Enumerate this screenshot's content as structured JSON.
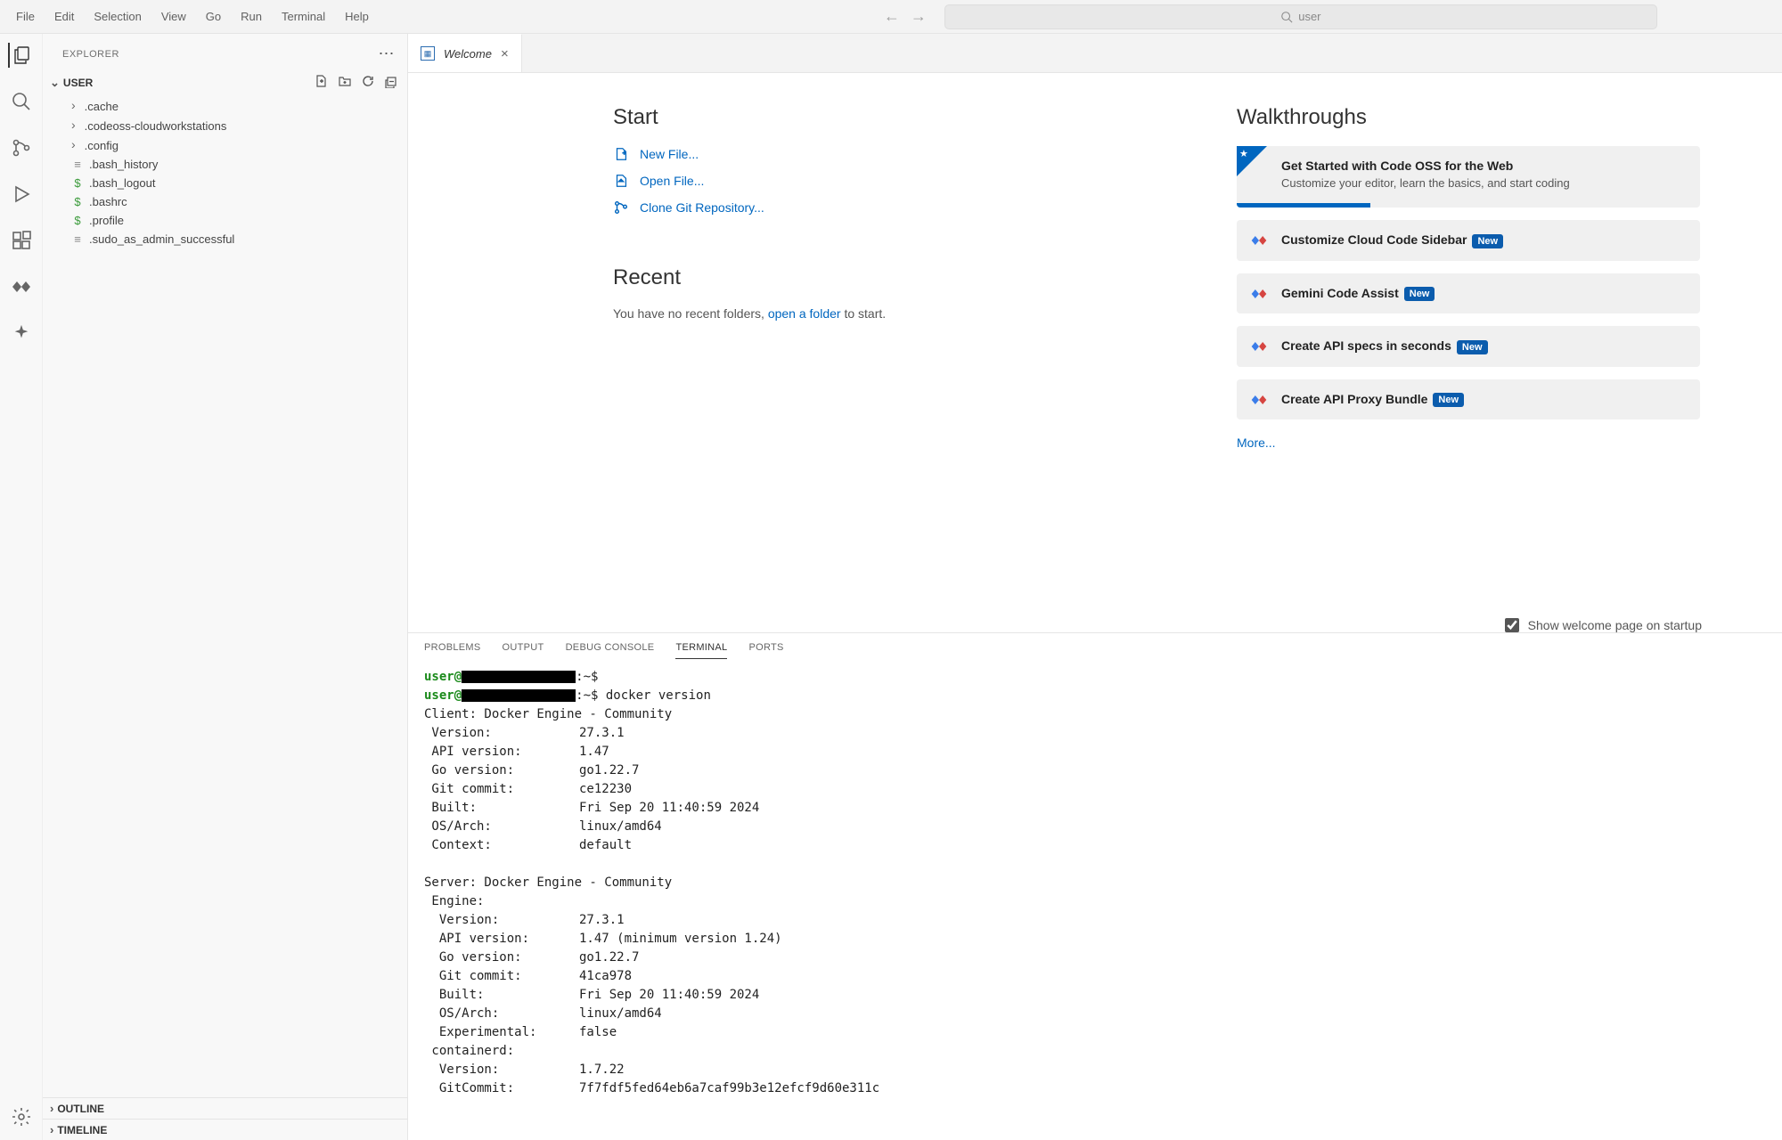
{
  "menubar": [
    "File",
    "Edit",
    "Selection",
    "View",
    "Go",
    "Run",
    "Terminal",
    "Help"
  ],
  "search": {
    "placeholder": "user"
  },
  "sidebar": {
    "title": "EXPLORER",
    "root": "USER",
    "folders": [
      ".cache",
      ".codeoss-cloudworkstations",
      ".config"
    ],
    "files": [
      {
        "icon": "≡",
        "name": ".bash_history",
        "iconColor": "#888"
      },
      {
        "icon": "$",
        "name": ".bash_logout",
        "iconColor": "#3a9a3a"
      },
      {
        "icon": "$",
        "name": ".bashrc",
        "iconColor": "#3a9a3a"
      },
      {
        "icon": "$",
        "name": ".profile",
        "iconColor": "#3a9a3a"
      },
      {
        "icon": "≡",
        "name": ".sudo_as_admin_successful",
        "iconColor": "#888"
      }
    ],
    "outline": "OUTLINE",
    "timeline": "TIMELINE"
  },
  "tab": {
    "label": "Welcome"
  },
  "welcome": {
    "start_heading": "Start",
    "actions": [
      {
        "icon": "new-file",
        "label": "New File..."
      },
      {
        "icon": "open-file",
        "label": "Open File..."
      },
      {
        "icon": "git",
        "label": "Clone Git Repository..."
      }
    ],
    "recent_heading": "Recent",
    "recent_prefix": "You have no recent folders, ",
    "recent_link": "open a folder",
    "recent_suffix": " to start.",
    "walk_heading": "Walkthroughs",
    "walkthroughs": [
      {
        "title": "Get Started with Code OSS for the Web",
        "sub": "Customize your editor, learn the basics, and start coding",
        "featured": true,
        "badge": false
      },
      {
        "title": "Customize Cloud Code Sidebar",
        "badge": true
      },
      {
        "title": "Gemini Code Assist",
        "badge": true
      },
      {
        "title": "Create API specs in seconds",
        "badge": true
      },
      {
        "title": "Create API Proxy Bundle",
        "badge": true
      }
    ],
    "more": "More...",
    "startup_label": "Show welcome page on startup"
  },
  "panel": {
    "tabs": [
      "PROBLEMS",
      "OUTPUT",
      "DEBUG CONSOLE",
      "TERMINAL",
      "PORTS"
    ],
    "active": "TERMINAL"
  },
  "terminal": {
    "prompt_user": "user@",
    "prompt_suffix": ":~$",
    "cmd": "docker version",
    "client_header": "Client: Docker Engine - Community",
    "client": [
      [
        " Version:",
        "27.3.1"
      ],
      [
        " API version:",
        "1.47"
      ],
      [
        " Go version:",
        "go1.22.7"
      ],
      [
        " Git commit:",
        "ce12230"
      ],
      [
        " Built:",
        "Fri Sep 20 11:40:59 2024"
      ],
      [
        " OS/Arch:",
        "linux/amd64"
      ],
      [
        " Context:",
        "default"
      ]
    ],
    "server_header": "Server: Docker Engine - Community",
    "engine_label": " Engine:",
    "engine": [
      [
        "  Version:",
        "27.3.1"
      ],
      [
        "  API version:",
        "1.47 (minimum version 1.24)"
      ],
      [
        "  Go version:",
        "go1.22.7"
      ],
      [
        "  Git commit:",
        "41ca978"
      ],
      [
        "  Built:",
        "Fri Sep 20 11:40:59 2024"
      ],
      [
        "  OS/Arch:",
        "linux/amd64"
      ],
      [
        "  Experimental:",
        "false"
      ]
    ],
    "containerd_label": " containerd:",
    "containerd": [
      [
        "  Version:",
        "1.7.22"
      ],
      [
        "  GitCommit:",
        "7f7fdf5fed64eb6a7caf99b3e12efcf9d60e311c"
      ]
    ]
  }
}
